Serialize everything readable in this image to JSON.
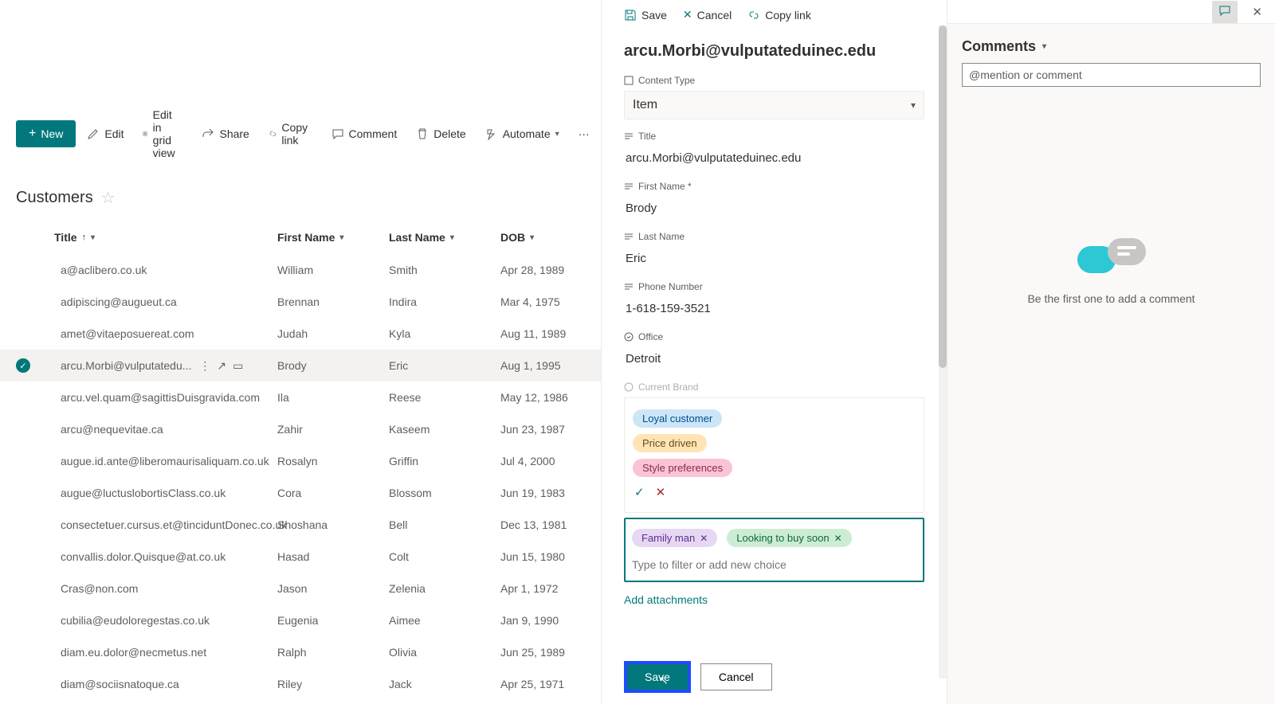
{
  "toolbar": {
    "new": "New",
    "edit": "Edit",
    "gridview": "Edit in grid view",
    "share": "Share",
    "copylink": "Copy link",
    "comment": "Comment",
    "delete": "Delete",
    "automate": "Automate"
  },
  "list": {
    "title": "Customers",
    "cols": {
      "title": "Title",
      "first": "First Name",
      "last": "Last Name",
      "dob": "DOB"
    }
  },
  "rows": [
    {
      "title": "a@aclibero.co.uk",
      "first": "William",
      "last": "Smith",
      "dob": "Apr 28, 1989"
    },
    {
      "title": "adipiscing@augueut.ca",
      "first": "Brennan",
      "last": "Indira",
      "dob": "Mar 4, 1975"
    },
    {
      "title": "amet@vitaeposuereat.com",
      "first": "Judah",
      "last": "Kyla",
      "dob": "Aug 11, 1989"
    },
    {
      "title": "arcu.Morbi@vulputatedu...",
      "first": "Brody",
      "last": "Eric",
      "dob": "Aug 1, 1995",
      "sel": true
    },
    {
      "title": "arcu.vel.quam@sagittisDuisgravida.com",
      "first": "Ila",
      "last": "Reese",
      "dob": "May 12, 1986"
    },
    {
      "title": "arcu@nequevitae.ca",
      "first": "Zahir",
      "last": "Kaseem",
      "dob": "Jun 23, 1987"
    },
    {
      "title": "augue.id.ante@liberomaurisaliquam.co.uk",
      "first": "Rosalyn",
      "last": "Griffin",
      "dob": "Jul 4, 2000"
    },
    {
      "title": "augue@luctuslobortisClass.co.uk",
      "first": "Cora",
      "last": "Blossom",
      "dob": "Jun 19, 1983"
    },
    {
      "title": "consectetuer.cursus.et@tinciduntDonec.co.uk",
      "first": "Shoshana",
      "last": "Bell",
      "dob": "Dec 13, 1981"
    },
    {
      "title": "convallis.dolor.Quisque@at.co.uk",
      "first": "Hasad",
      "last": "Colt",
      "dob": "Jun 15, 1980"
    },
    {
      "title": "Cras@non.com",
      "first": "Jason",
      "last": "Zelenia",
      "dob": "Apr 1, 1972"
    },
    {
      "title": "cubilia@eudoloregestas.co.uk",
      "first": "Eugenia",
      "last": "Aimee",
      "dob": "Jan 9, 1990"
    },
    {
      "title": "diam.eu.dolor@necmetus.net",
      "first": "Ralph",
      "last": "Olivia",
      "dob": "Jun 25, 1989"
    },
    {
      "title": "diam@sociisnatoque.ca",
      "first": "Riley",
      "last": "Jack",
      "dob": "Apr 25, 1971"
    }
  ],
  "panel": {
    "tb": {
      "save": "Save",
      "cancel": "Cancel",
      "copylink": "Copy link"
    },
    "heading": "arcu.Morbi@vulputateduinec.edu",
    "fields": {
      "contenttype": {
        "label": "Content Type",
        "value": "Item"
      },
      "title": {
        "label": "Title",
        "value": "arcu.Morbi@vulputateduinec.edu"
      },
      "first": {
        "label": "First Name *",
        "value": "Brody"
      },
      "last": {
        "label": "Last Name",
        "value": "Eric"
      },
      "phone": {
        "label": "Phone Number",
        "value": "1-618-159-3521"
      },
      "office": {
        "label": "Office",
        "value": "Detroit"
      },
      "brand": {
        "label": "Current Brand"
      }
    },
    "choices": {
      "opt1": "Loyal customer",
      "opt2": "Price driven",
      "opt3": "Style preferences"
    },
    "selected": {
      "s1": "Family man",
      "s2": "Looking to buy soon"
    },
    "filter_placeholder": "Type to filter or add new choice",
    "attachments": "Add attachments",
    "footer": {
      "save": "Save",
      "cancel": "Cancel"
    }
  },
  "comments": {
    "header": "Comments",
    "placeholder": "@mention or comment",
    "empty": "Be the first one to add a comment"
  }
}
